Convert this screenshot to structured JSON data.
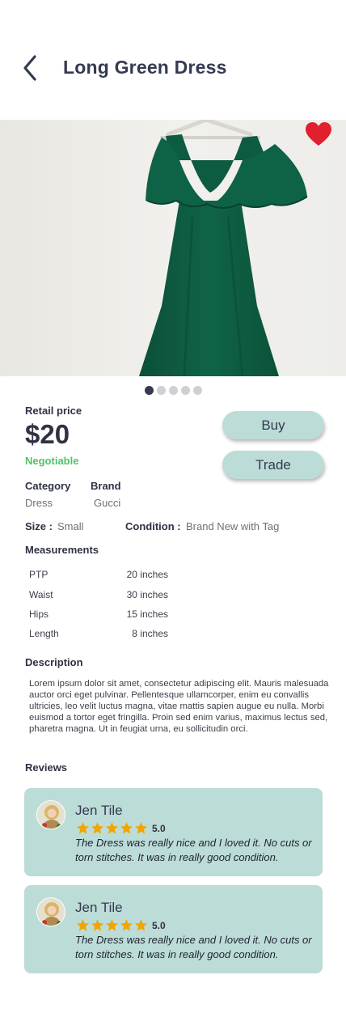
{
  "header": {
    "title": "Long Green Dress"
  },
  "carousel": {
    "total": 5,
    "active_index": 0
  },
  "product": {
    "retail_label": "Retail price",
    "price": "$20",
    "negotiable": "Negotiable",
    "buy_label": "Buy",
    "trade_label": "Trade",
    "category_label": "Category",
    "category_value": "Dress",
    "brand_label": "Brand",
    "brand_value": "Gucci",
    "size_label": "Size :",
    "size_value": "Small",
    "condition_label": "Condition :",
    "condition_value": "Brand New with Tag",
    "favorite": true
  },
  "measurements": {
    "title": "Measurements",
    "rows": [
      {
        "name": "PTP",
        "value": "20 inches"
      },
      {
        "name": "Waist",
        "value": "30 inches"
      },
      {
        "name": "Hips",
        "value": "15 inches"
      },
      {
        "name": "Length",
        "value": "8 inches"
      }
    ]
  },
  "description": {
    "title": "Description",
    "text": "Lorem ipsum dolor sit amet, consectetur adipiscing elit. Mauris malesuada auctor orci eget pulvinar. Pellentesque ullamcorper, enim eu convallis ultricies, leo velit luctus magna, vitae mattis sapien augue eu nulla. Morbi euismod a tortor eget fringilla. Proin sed enim varius, maximus lectus sed, pharetra magna. Ut in feugiat urna, eu sollicitudin orci."
  },
  "reviews": {
    "title": "Reviews",
    "items": [
      {
        "name": "Jen Tile",
        "rating": "5.0",
        "stars": 5,
        "text": "The Dress was really nice and I loved it. No cuts or torn stitches. It was in really good condition."
      },
      {
        "name": "Jen Tile",
        "rating": "5.0",
        "stars": 5,
        "text": "The Dress was really nice and I loved it. No cuts or torn stitches. It was in really good condition."
      }
    ]
  },
  "colors": {
    "accent": "#bcdcd7",
    "negotiable": "#4ec46a",
    "heart": "#e0202e",
    "star": "#f2a500",
    "text_dark": "#353a52"
  }
}
